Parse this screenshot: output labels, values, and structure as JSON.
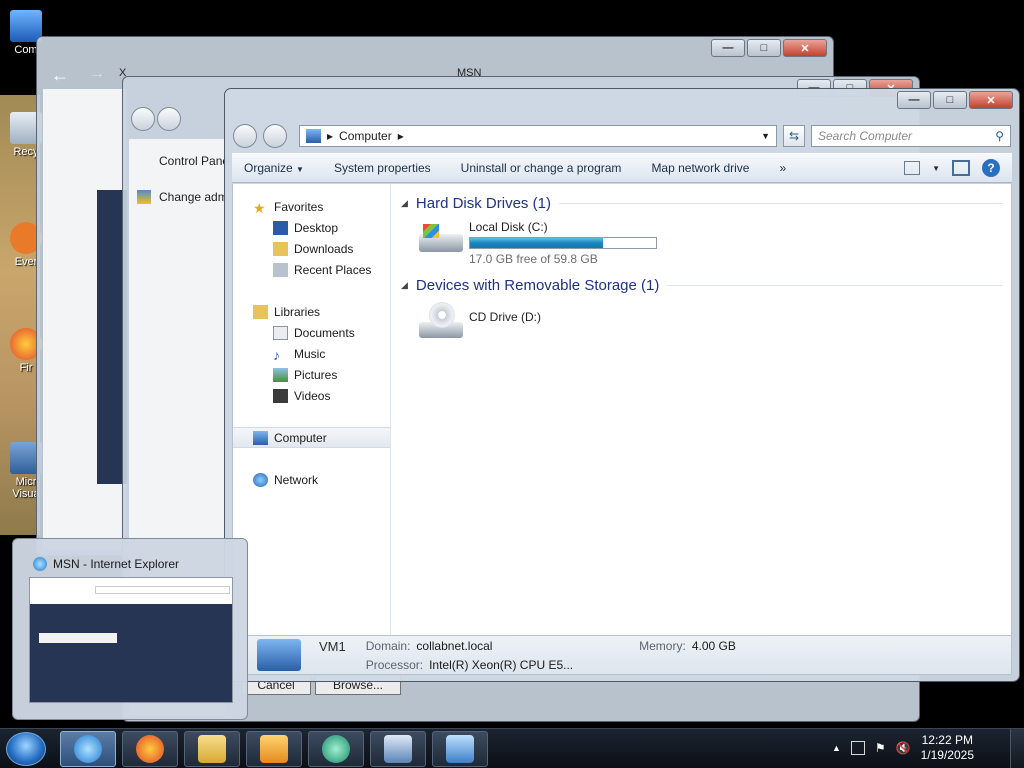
{
  "desktop": {
    "icons": [
      {
        "label": "Com",
        "icon": "computer-icon"
      },
      {
        "label": "Recy",
        "icon": "recycle-bin-icon"
      },
      {
        "label": "Ever",
        "icon": "shortcut-icon"
      },
      {
        "label": "Fir",
        "icon": "firefox-icon"
      },
      {
        "label": "Micr Visua",
        "icon": "visual-studio-icon"
      }
    ]
  },
  "background_windows": {
    "control_panel": {
      "breadcrumb": "Control Pane",
      "link": "Change adm"
    },
    "browser": {
      "tab1": "X",
      "tab2": "MSN"
    },
    "dialog_buttons": {
      "cancel": "Cancel",
      "browse": "Browse..."
    }
  },
  "explorer": {
    "address": {
      "root_label": "Computer"
    },
    "search_placeholder": "Search Computer",
    "toolbar": {
      "organize": "Organize",
      "system_properties": "System properties",
      "uninstall": "Uninstall or change a program",
      "map_drive": "Map network drive",
      "more": "»"
    },
    "nav": {
      "favorites": "Favorites",
      "desktop": "Desktop",
      "downloads": "Downloads",
      "recent": "Recent Places",
      "libraries": "Libraries",
      "documents": "Documents",
      "music": "Music",
      "pictures": "Pictures",
      "videos": "Videos",
      "computer": "Computer",
      "network": "Network"
    },
    "groups": {
      "hdd": "Hard Disk Drives (1)",
      "removable": "Devices with Removable Storage (1)"
    },
    "drives": {
      "local": {
        "name": "Local Disk (C:)",
        "free_text": "17.0 GB free of 59.8 GB",
        "used_fraction": 0.716
      },
      "cd": {
        "name": "CD Drive (D:)"
      }
    },
    "details": {
      "name": "VM1",
      "domain_label": "Domain:",
      "domain": "collabnet.local",
      "memory_label": "Memory:",
      "memory": "4.00 GB",
      "processor_label": "Processor:",
      "processor": "Intel(R) Xeon(R) CPU E5..."
    }
  },
  "thumbnail": {
    "title": "MSN - Internet Explorer"
  },
  "taskbar": {
    "time": "12:22 PM",
    "date": "1/19/2025"
  },
  "colors": {
    "accent": "#1e3287",
    "progress": "#1a86bd",
    "taskbar": "#0b1016"
  }
}
